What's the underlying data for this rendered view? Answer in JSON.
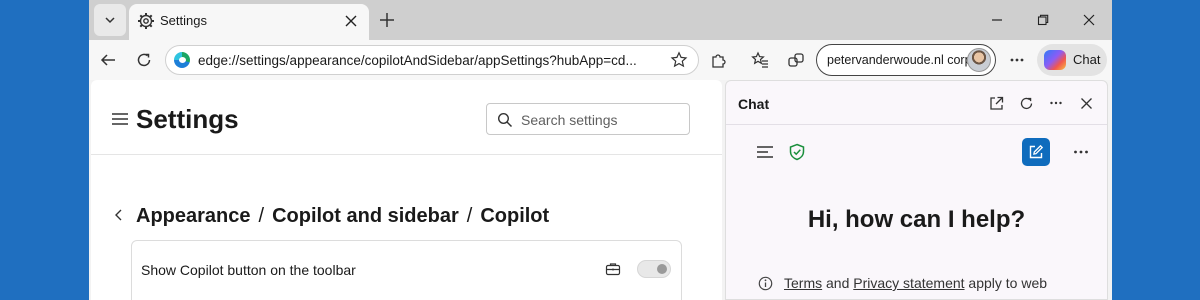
{
  "tab": {
    "title": "Settings"
  },
  "toolbar": {
    "address": "edge://settings/appearance/copilotAndSidebar/appSettings?hubApp=cd...",
    "profile_name": "petervanderwoude.nl corp",
    "copilot_label": "Chat"
  },
  "settings": {
    "title": "Settings",
    "search_placeholder": "Search settings",
    "breadcrumb": [
      "Appearance",
      "Copilot and sidebar",
      "Copilot"
    ],
    "breadcrumb_sep": "/",
    "option_label": "Show Copilot button on the toolbar",
    "option_enabled": false
  },
  "chat": {
    "title": "Chat",
    "greeting": "Hi, how can I help?",
    "notice_terms": "Terms",
    "notice_and": "and",
    "notice_privacy": "Privacy statement",
    "notice_rest": "apply to web"
  },
  "colors": {
    "desktop": "#1f6fc0",
    "accent": "#0f6cbd",
    "shield": "#1a8f3c"
  },
  "icons": [
    "tab-list-icon",
    "settings-gear-icon",
    "close-icon",
    "plus-icon",
    "minimize-icon",
    "restore-icon",
    "back-arrow-icon",
    "refresh-icon",
    "edge-logo-icon",
    "star-icon",
    "extensions-icon",
    "favorites-icon",
    "collections-icon",
    "more-icon",
    "copilot-logo-icon",
    "hamburger-icon",
    "search-icon",
    "chevron-left-icon",
    "briefcase-icon",
    "open-external-icon",
    "shield-check-icon",
    "compose-icon",
    "info-icon"
  ]
}
